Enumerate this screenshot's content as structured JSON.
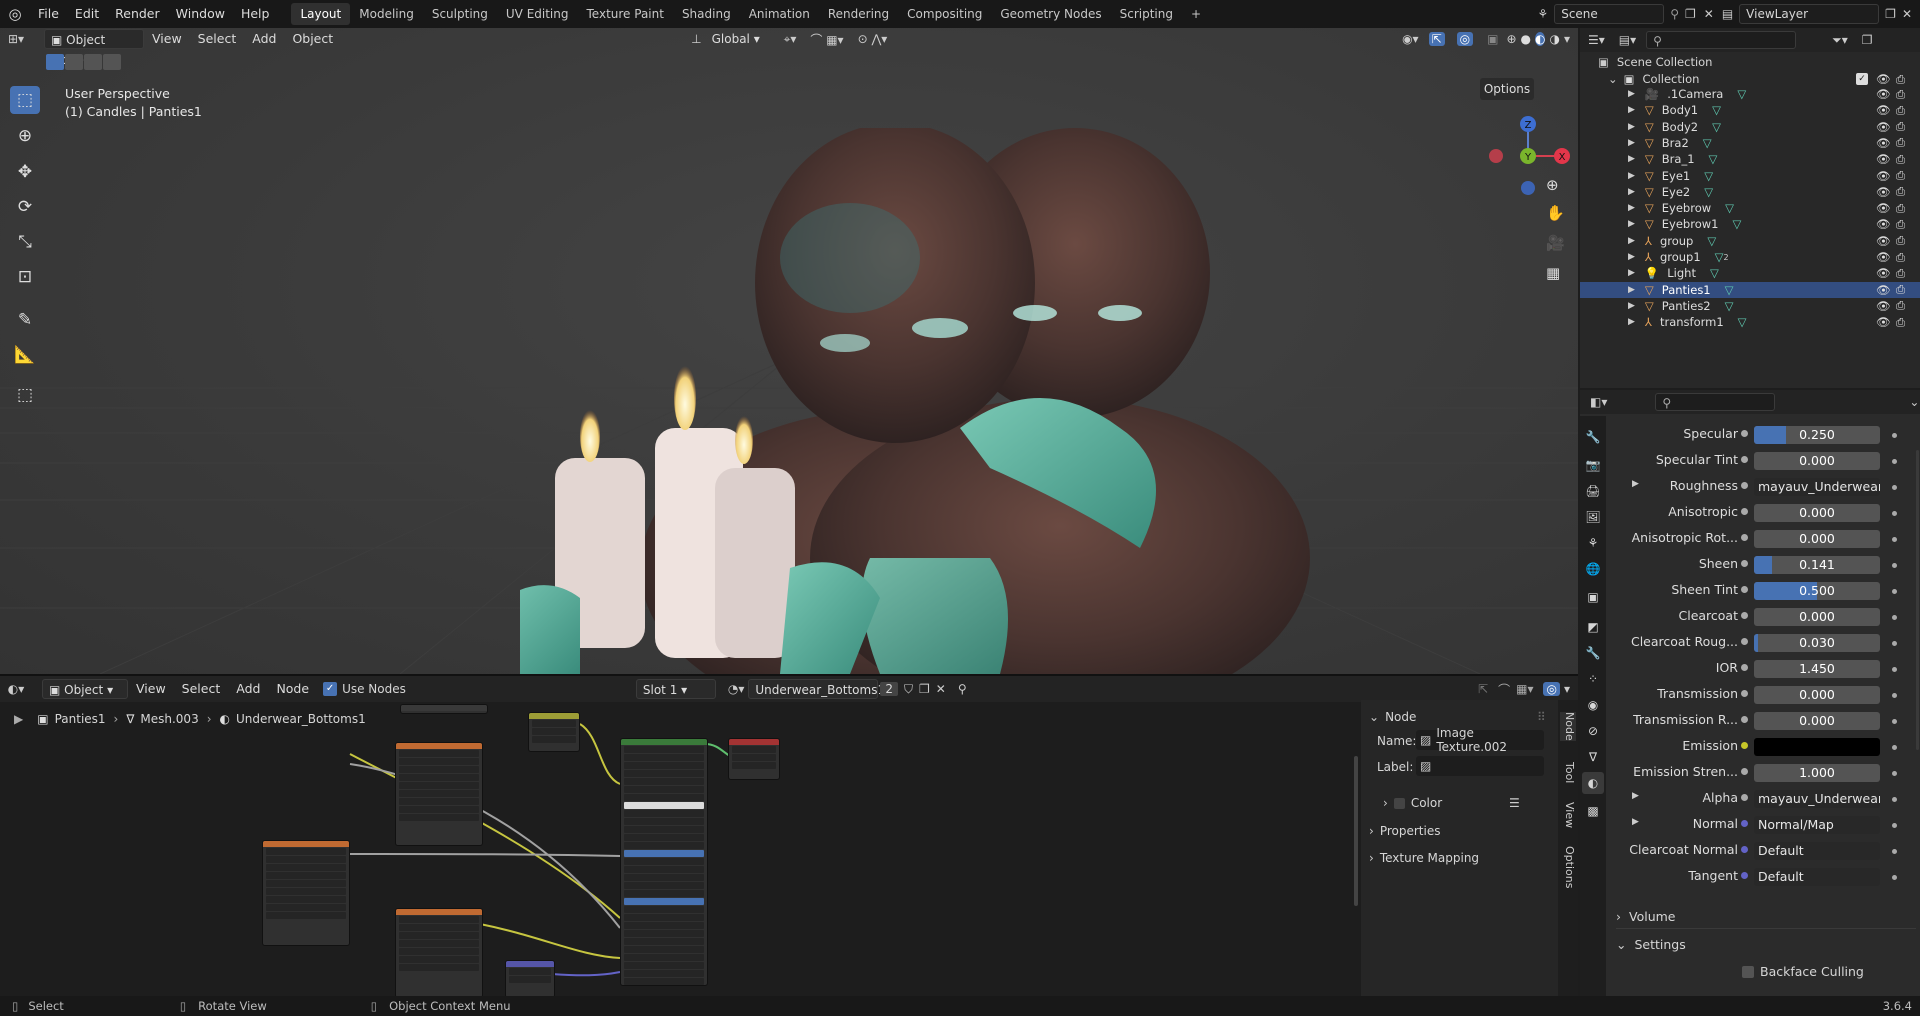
{
  "topbar": {
    "menus": [
      "File",
      "Edit",
      "Render",
      "Window",
      "Help"
    ],
    "workspaces": [
      "Layout",
      "Modeling",
      "Sculpting",
      "UV Editing",
      "Texture Paint",
      "Shading",
      "Animation",
      "Rendering",
      "Compositing",
      "Geometry Nodes",
      "Scripting"
    ],
    "active_workspace": "Layout",
    "scene": "Scene",
    "view_layer": "ViewLayer"
  },
  "viewport": {
    "mode": "Object Mode",
    "menus": [
      "View",
      "Select",
      "Add",
      "Object"
    ],
    "orientation": "Global",
    "options": "Options",
    "overlay_title": "User Perspective",
    "overlay_sub": "(1) Candles | Panties1",
    "gizmo": {
      "z": "Z",
      "y": "Y",
      "x": "X"
    }
  },
  "node_editor": {
    "type": "Object",
    "menus": [
      "View",
      "Select",
      "Add",
      "Node"
    ],
    "use_nodes": "Use Nodes",
    "slot": "Slot 1",
    "material": "Underwear_Bottoms1",
    "users": "2",
    "breadcrumb": [
      "Panties1",
      "Mesh.003",
      "Underwear_Bottoms1"
    ],
    "sidebar": {
      "section": "Node",
      "name_label": "Name:",
      "name_value": "Image Texture.002",
      "label_label": "Label:",
      "color": "Color",
      "properties": "Properties",
      "texture_mapping": "Texture Mapping",
      "tabs": [
        "Node",
        "Tool",
        "View",
        "Options"
      ]
    }
  },
  "outliner": {
    "root": "Scene Collection",
    "collection": "Collection",
    "items": [
      {
        "name": ".1Camera",
        "selected": false
      },
      {
        "name": "Body1",
        "selected": false
      },
      {
        "name": "Body2",
        "selected": false
      },
      {
        "name": "Bra2",
        "selected": false
      },
      {
        "name": "Bra_1",
        "selected": false
      },
      {
        "name": "Eye1",
        "selected": false
      },
      {
        "name": "Eye2",
        "selected": false
      },
      {
        "name": "Eyebrow",
        "selected": false
      },
      {
        "name": "Eyebrow1",
        "selected": false
      },
      {
        "name": "group",
        "selected": false
      },
      {
        "name": "group1",
        "selected": false
      },
      {
        "name": "Light",
        "selected": false
      },
      {
        "name": "Panties1",
        "selected": true
      },
      {
        "name": "Panties2",
        "selected": false
      },
      {
        "name": "transform1",
        "selected": false
      }
    ],
    "group1_count": "2"
  },
  "properties": {
    "rows": [
      {
        "label": "Specular",
        "value": "0.250",
        "type": "slider",
        "fill": 0.25
      },
      {
        "label": "Specular Tint",
        "value": "0.000",
        "type": "slider",
        "fill": 0
      },
      {
        "label": "Roughness",
        "value": "mayauv_Underwear_...",
        "type": "link"
      },
      {
        "label": "Anisotropic",
        "value": "0.000",
        "type": "slider",
        "fill": 0
      },
      {
        "label": "Anisotropic Rot...",
        "value": "0.000",
        "type": "slider",
        "fill": 0
      },
      {
        "label": "Sheen",
        "value": "0.141",
        "type": "slider",
        "fill": 0.141
      },
      {
        "label": "Sheen Tint",
        "value": "0.500",
        "type": "slider",
        "fill": 0.5
      },
      {
        "label": "Clearcoat",
        "value": "0.000",
        "type": "slider",
        "fill": 0
      },
      {
        "label": "Clearcoat Roug...",
        "value": "0.030",
        "type": "slider",
        "fill": 0.03
      },
      {
        "label": "IOR",
        "value": "1.450",
        "type": "slider",
        "fill": 0
      },
      {
        "label": "Transmission",
        "value": "0.000",
        "type": "slider",
        "fill": 0
      },
      {
        "label": "Transmission R...",
        "value": "0.000",
        "type": "slider",
        "fill": 0
      },
      {
        "label": "Emission",
        "value": "",
        "type": "color"
      },
      {
        "label": "Emission Stren...",
        "value": "1.000",
        "type": "slider",
        "fill": 0
      },
      {
        "label": "Alpha",
        "value": "mayauv_Underwear_...",
        "type": "link"
      },
      {
        "label": "Normal",
        "value": "Normal/Map",
        "type": "link"
      },
      {
        "label": "Clearcoat Normal",
        "value": "Default",
        "type": "field"
      },
      {
        "label": "Tangent",
        "value": "Default",
        "type": "field"
      }
    ],
    "volume": "Volume",
    "settings": "Settings",
    "backface": "Backface Culling"
  },
  "statusbar": {
    "select": "Select",
    "rotate": "Rotate View",
    "context": "Object Context Menu",
    "version": "3.6.4"
  },
  "colors": {
    "accent": "#4772b3",
    "selected_row": "#334d80",
    "emission": "#000000"
  }
}
